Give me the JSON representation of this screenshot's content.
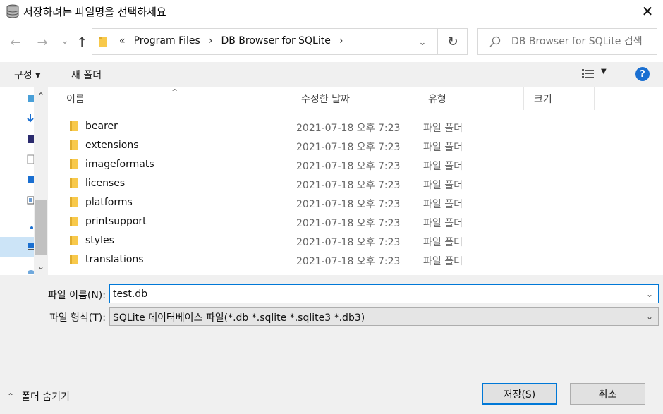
{
  "window": {
    "title": "저장하려는 파일명을 선택하세요",
    "close_glyph": "✕"
  },
  "nav": {
    "back_glyph": "←",
    "forward_glyph": "→",
    "recent_glyph": "⌄",
    "up_glyph": "↑",
    "breadcrumb_prefix": "«",
    "breadcrumbs": [
      "Program Files",
      "DB Browser for SQLite"
    ],
    "crumb_sep": "›",
    "dropdown_glyph": "⌄",
    "refresh_glyph": "↻",
    "search_placeholder": "DB Browser for SQLite 검색"
  },
  "toolbar": {
    "organize_label": "구성 ▾",
    "new_folder_label": "새 폴더",
    "view_dropdown_glyph": "▼",
    "help_glyph": "?"
  },
  "columns": {
    "name": "이름",
    "modified": "수정한 날짜",
    "type": "유형",
    "size": "크기",
    "sort_glyph": "^"
  },
  "scrollbar": {
    "up_glyph": "⌃",
    "down_glyph": "⌄"
  },
  "files": [
    {
      "name": "bearer",
      "modified": "2021-07-18 오후 7:23",
      "type": "파일 폴더"
    },
    {
      "name": "extensions",
      "modified": "2021-07-18 오후 7:23",
      "type": "파일 폴더"
    },
    {
      "name": "imageformats",
      "modified": "2021-07-18 오후 7:23",
      "type": "파일 폴더"
    },
    {
      "name": "licenses",
      "modified": "2021-07-18 오후 7:23",
      "type": "파일 폴더"
    },
    {
      "name": "platforms",
      "modified": "2021-07-18 오후 7:23",
      "type": "파일 폴더"
    },
    {
      "name": "printsupport",
      "modified": "2021-07-18 오후 7:23",
      "type": "파일 폴더"
    },
    {
      "name": "styles",
      "modified": "2021-07-18 오후 7:23",
      "type": "파일 폴더"
    },
    {
      "name": "translations",
      "modified": "2021-07-18 오후 7:23",
      "type": "파일 폴더"
    }
  ],
  "form": {
    "filename_label": "파일 이름(N):",
    "filename_value": "test.db",
    "filetype_label": "파일 형식(T):",
    "filetype_value": "SQLite 데이터베이스 파일(*.db *.sqlite *.sqlite3 *.db3)",
    "dropdown_glyph": "⌄"
  },
  "footer": {
    "hide_folders_glyph": "⌃",
    "hide_folders_label": "폴더 숨기기",
    "save_label": "저장(S)",
    "cancel_label": "취소"
  },
  "colors": {
    "accent": "#0078d7",
    "folder": "#f8c94b",
    "selected": "#cce4f7",
    "help": "#1a6fd1"
  }
}
